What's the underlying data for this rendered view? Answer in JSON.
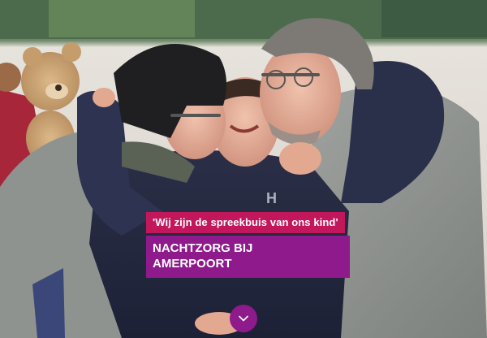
{
  "hero": {
    "quote": "'Wij zijn de spreekbuis van ons kind'",
    "title_line1": "NACHTZORG BIJ",
    "title_line2": "AMERPOORT",
    "scroll_icon": "chevron-down-icon",
    "colors": {
      "quote_bg": "#c2185b",
      "title_bg": "#8e1a8b",
      "button_bg": "#8e1a8b"
    }
  }
}
